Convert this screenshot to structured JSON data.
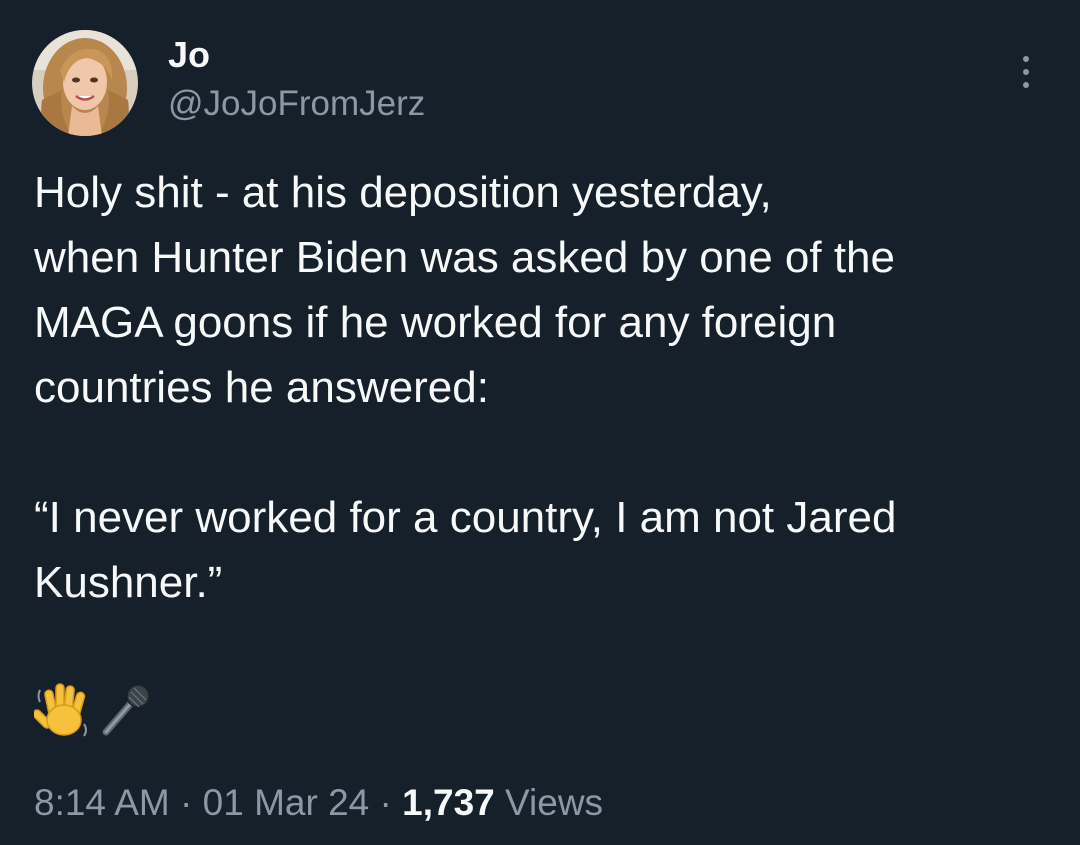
{
  "author": {
    "display_name": "Jo",
    "handle": "@JoJoFromJerz"
  },
  "tweet": {
    "text": "Holy shit - at his deposition yesterday,\nwhen Hunter Biden was asked by one of the\nMAGA goons if he worked for any foreign\ncountries he answered:\n\n“I never worked for a country, I am not Jared\nKushner.”",
    "emojis": [
      "waving-hand-icon",
      "microphone-icon"
    ]
  },
  "meta": {
    "time": "8:14 AM",
    "separator": "·",
    "date": "01 Mar 24",
    "views_count": "1,737",
    "views_label": "Views"
  },
  "colors": {
    "background": "#15202b",
    "primary_text": "#f7f9f9",
    "secondary_text": "#8b98a5"
  }
}
